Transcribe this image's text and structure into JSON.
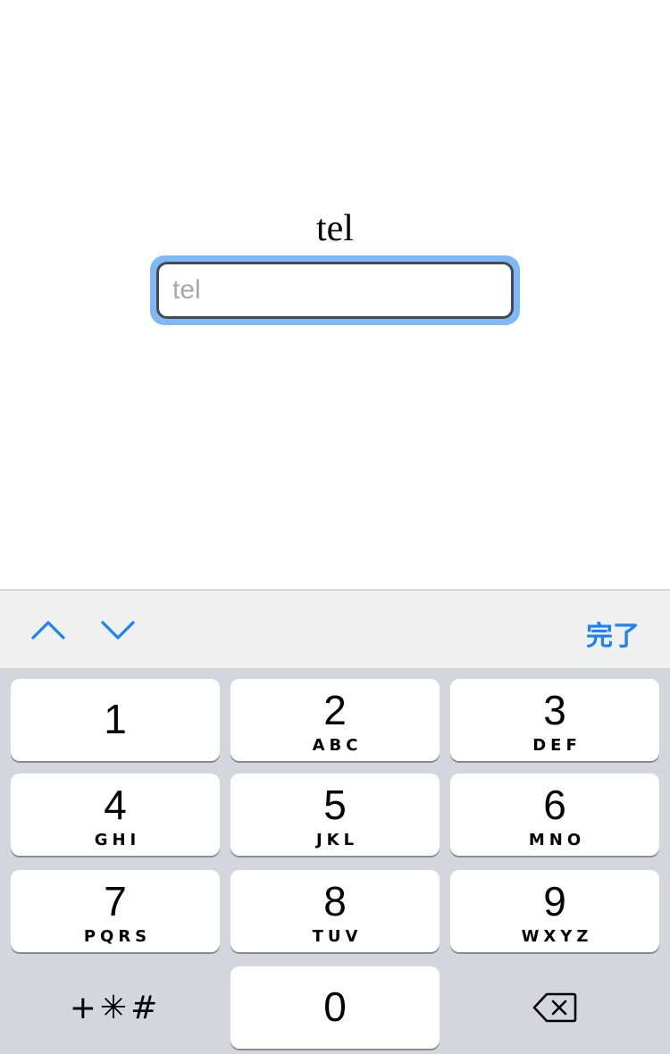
{
  "form": {
    "label": "tel",
    "input_value": "",
    "input_placeholder": "tel"
  },
  "toolbar": {
    "prev_icon": "chevron-up-icon",
    "next_icon": "chevron-down-icon",
    "done_label": "完了",
    "accent_color": "#1a82fb"
  },
  "keyboard": {
    "keys": [
      {
        "digit": "1",
        "letters": ""
      },
      {
        "digit": "2",
        "letters": "ABC"
      },
      {
        "digit": "3",
        "letters": "DEF"
      },
      {
        "digit": "4",
        "letters": "GHI"
      },
      {
        "digit": "5",
        "letters": "JKL"
      },
      {
        "digit": "6",
        "letters": "MNO"
      },
      {
        "digit": "7",
        "letters": "PQRS"
      },
      {
        "digit": "8",
        "letters": "TUV"
      },
      {
        "digit": "9",
        "letters": "WXYZ"
      },
      {
        "digit": "0",
        "letters": ""
      }
    ],
    "symbols_label": "+✳#",
    "delete_icon": "backspace-icon"
  }
}
